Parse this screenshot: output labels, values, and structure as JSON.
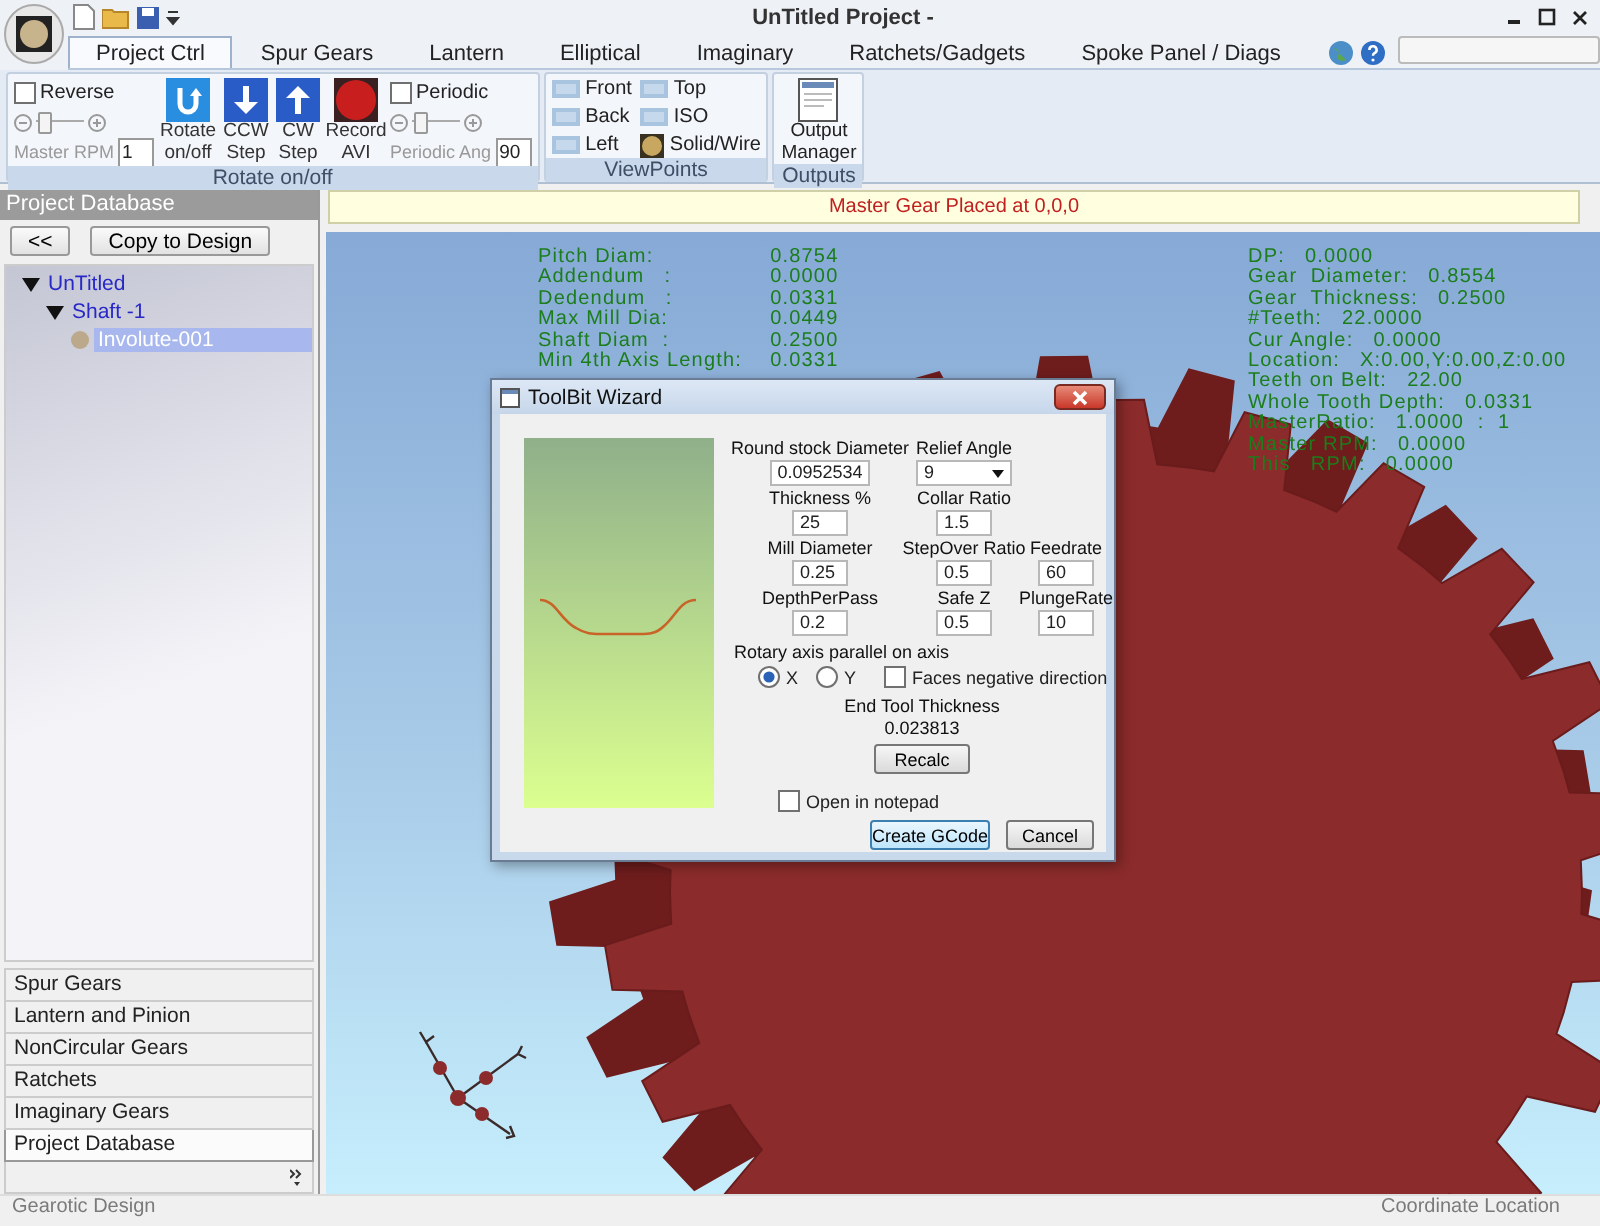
{
  "window": {
    "title": "UnTitled Project -"
  },
  "tabs": [
    {
      "label": "Project Ctrl",
      "selected": true
    },
    {
      "label": "Spur Gears",
      "selected": false
    },
    {
      "label": "Lantern",
      "selected": false
    },
    {
      "label": "Elliptical",
      "selected": false
    },
    {
      "label": "Imaginary",
      "selected": false
    },
    {
      "label": "Ratchets/Gadgets",
      "selected": false
    },
    {
      "label": "Spoke Panel / Diags",
      "selected": false
    }
  ],
  "rotate_group": {
    "label": "Rotate on/off",
    "reverse": {
      "label": "Reverse",
      "checked": false
    },
    "master_rpm": {
      "label": "Master RPM",
      "level": 0.15,
      "value": "1"
    },
    "buttons": [
      {
        "label": "Rotate on/off",
        "kind": "rotate"
      },
      {
        "label": "CCW Step",
        "kind": "down"
      },
      {
        "label": "CW Step",
        "kind": "up"
      },
      {
        "label": "Record AVI",
        "kind": "record"
      }
    ],
    "periodic": {
      "label": "Periodic",
      "checked": false
    },
    "periodic_ang": {
      "label": "Periodic Ang",
      "level": 0.15,
      "value": "90"
    }
  },
  "viewpoints": {
    "label": "ViewPoints",
    "items": [
      {
        "label": "Front",
        "kind": "view"
      },
      {
        "label": "Top",
        "kind": "view"
      },
      {
        "label": "Back",
        "kind": "view"
      },
      {
        "label": "ISO",
        "kind": "view"
      },
      {
        "label": "Left",
        "kind": "view"
      },
      {
        "label": "Solid/Wire",
        "kind": "solid"
      }
    ]
  },
  "outputs": {
    "label": "Outputs",
    "button": "Output Manager"
  },
  "sidebar": {
    "title": "Project Database",
    "buttons": [
      "<<",
      "Copy to Design"
    ],
    "tree": [
      {
        "label": "UnTitled",
        "expanded": true,
        "selected": false,
        "children": [
          {
            "label": "Shaft -1",
            "expanded": true,
            "selected": false,
            "children": [
              {
                "label": "Involute-001",
                "selected": true
              }
            ]
          }
        ]
      }
    ],
    "nav": [
      {
        "label": "Spur Gears",
        "selected": false
      },
      {
        "label": "Lantern and Pinion",
        "selected": false
      },
      {
        "label": "NonCircular Gears",
        "selected": false
      },
      {
        "label": "Ratchets",
        "selected": false
      },
      {
        "label": "Imaginary Gears",
        "selected": false
      },
      {
        "label": "Project Database",
        "selected": true
      }
    ]
  },
  "message": "Master Gear Placed at 0,0,0",
  "stats_left": [
    {
      "label": "Pitch Diam:",
      "value": "0.8754"
    },
    {
      "label": "Addendum   :",
      "value": "0.0000"
    },
    {
      "label": "Dedendum   :",
      "value": "0.0331"
    },
    {
      "label": "Max Mill Dia:",
      "value": "0.0449"
    },
    {
      "label": "Shaft Diam  :",
      "value": "0.2500"
    },
    {
      "label": "Min 4th Axis Length:",
      "value": "0.0331"
    }
  ],
  "stats_right": [
    {
      "label": "DP:",
      "value": "0.0000"
    },
    {
      "label": "Gear  Diameter:",
      "value": "0.8554"
    },
    {
      "label": "Gear  Thickness:",
      "value": "0.2500"
    },
    {
      "label": "#Teeth:",
      "value": "22.0000"
    },
    {
      "label": "Cur Angle:",
      "value": "0.0000"
    },
    {
      "label": "Location:",
      "value": "X:0.00,Y:0.00,Z:0.00"
    },
    {
      "label": "Teeth on Belt:",
      "value": "22.00"
    },
    {
      "label": "Whole Tooth Depth:",
      "value": "0.0331"
    },
    {
      "label": "MasterRatio:",
      "value": "1.0000  :  1"
    },
    {
      "label": "Master RPM:",
      "value": "0.0000"
    },
    {
      "label": "This   RPM:",
      "value": "0.0000"
    }
  ],
  "dialog": {
    "title": "ToolBit Wizard",
    "rows": [
      [
        {
          "label": "Round stock Diameter",
          "value": "0.0952534",
          "kind": "text"
        },
        {
          "label": "Relief Angle",
          "value": "9",
          "kind": "dropdown"
        }
      ],
      [
        {
          "label": "Thickness %",
          "value": "25",
          "kind": "text"
        },
        {
          "label": "Collar Ratio",
          "value": "1.5",
          "kind": "text"
        }
      ],
      [
        {
          "label": "Mill Diameter",
          "value": "0.25",
          "kind": "text"
        },
        {
          "label": "StepOver Ratio",
          "value": "0.5",
          "kind": "text"
        },
        {
          "label": "Feedrate",
          "value": "60",
          "kind": "text"
        }
      ],
      [
        {
          "label": "DepthPerPass",
          "value": "0.2",
          "kind": "text"
        },
        {
          "label": "Safe Z",
          "value": "0.5",
          "kind": "text"
        },
        {
          "label": "PlungeRate",
          "value": "10",
          "kind": "text"
        }
      ]
    ],
    "axis_label": "Rotary axis parallel on axis",
    "axes": [
      {
        "label": "X",
        "selected": true
      },
      {
        "label": "Y",
        "selected": false
      }
    ],
    "faces_negative": {
      "label": "Faces negative direction",
      "checked": false
    },
    "end_tool_label": "End Tool Thickness",
    "end_tool_value": "0.023813",
    "recalc": "Recalc",
    "open_notepad": {
      "label": "Open in notepad",
      "checked": false
    },
    "buttons": [
      {
        "label": "Create GCode",
        "selected": true
      },
      {
        "label": "Cancel",
        "selected": false
      }
    ]
  },
  "status_bar": {
    "left": "Gearotic Design",
    "right": "Coordinate Location"
  }
}
